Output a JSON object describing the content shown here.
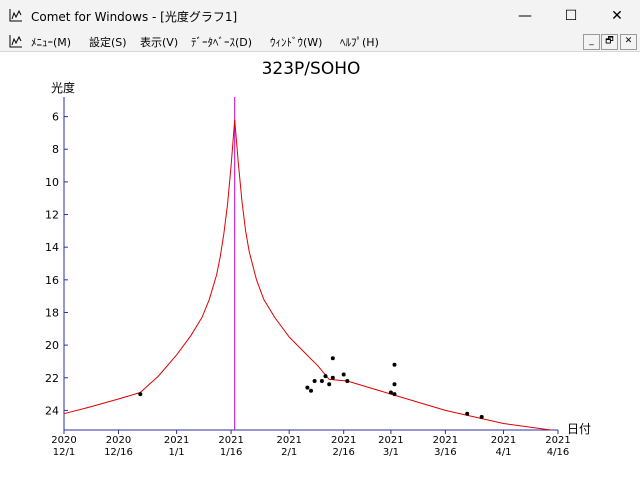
{
  "window": {
    "title": "Comet for Windows - [光度グラフ1]",
    "minimize_glyph": "—",
    "maximize_glyph": "☐",
    "close_glyph": "✕"
  },
  "menu": {
    "items": [
      {
        "label": "ﾒﾆｭｰ(M)"
      },
      {
        "label": "設定(S)"
      },
      {
        "label": "表示(V)"
      },
      {
        "label": "ﾃﾞｰﾀﾍﾞｰｽ(D)"
      },
      {
        "label": "ｳｨﾝﾄﾞｳ(W)"
      },
      {
        "label": "ﾍﾙﾌﾟ(H)"
      }
    ],
    "mdi_minimize": "_",
    "mdi_restore": "🗗",
    "mdi_close": "✕"
  },
  "chart_data": {
    "type": "line",
    "title": "323P/SOHO",
    "ylabel": "光度",
    "xlabel": "日付",
    "y_reversed": true,
    "ylim": [
      25.2,
      4.8
    ],
    "xlim": [
      "2020-12-01",
      "2021-04-16"
    ],
    "yticks": [
      6,
      8,
      10,
      12,
      14,
      16,
      18,
      20,
      22,
      24
    ],
    "xticks": [
      {
        "date": "2020-12-01",
        "line1": "2020",
        "line2": "12/1"
      },
      {
        "date": "2020-12-16",
        "line1": "2020",
        "line2": "12/16"
      },
      {
        "date": "2021-01-01",
        "line1": "2021",
        "line2": "1/1"
      },
      {
        "date": "2021-01-16",
        "line1": "2021",
        "line2": "1/16"
      },
      {
        "date": "2021-02-01",
        "line1": "2021",
        "line2": "2/1"
      },
      {
        "date": "2021-02-16",
        "line1": "2021",
        "line2": "2/16"
      },
      {
        "date": "2021-03-01",
        "line1": "2021",
        "line2": "3/1"
      },
      {
        "date": "2021-03-16",
        "line1": "2021",
        "line2": "3/16"
      },
      {
        "date": "2021-04-01",
        "line1": "2021",
        "line2": "4/1"
      },
      {
        "date": "2021-04-16",
        "line1": "2021",
        "line2": "4/16"
      }
    ],
    "perihelion_date": "2021-01-17",
    "predicted_curve": {
      "color": "#e00000",
      "points": [
        [
          "2020-12-01",
          24.2
        ],
        [
          "2020-12-08",
          23.8
        ],
        [
          "2020-12-16",
          23.3
        ],
        [
          "2020-12-22",
          22.9
        ],
        [
          "2020-12-27",
          21.9
        ],
        [
          "2021-01-01",
          20.6
        ],
        [
          "2021-01-05",
          19.4
        ],
        [
          "2021-01-08",
          18.3
        ],
        [
          "2021-01-10",
          17.2
        ],
        [
          "2021-01-12",
          15.7
        ],
        [
          "2021-01-13",
          14.6
        ],
        [
          "2021-01-14",
          13.2
        ],
        [
          "2021-01-15",
          11.4
        ],
        [
          "2021-01-16",
          9.0
        ],
        [
          "2021-01-17",
          6.2
        ],
        [
          "2021-01-18",
          8.9
        ],
        [
          "2021-01-19",
          11.2
        ],
        [
          "2021-01-20",
          13.0
        ],
        [
          "2021-01-21",
          14.3
        ],
        [
          "2021-01-23",
          16.0
        ],
        [
          "2021-01-25",
          17.2
        ],
        [
          "2021-01-28",
          18.3
        ],
        [
          "2021-02-01",
          19.5
        ],
        [
          "2021-02-05",
          20.4
        ],
        [
          "2021-02-09",
          21.3
        ],
        [
          "2021-02-12",
          22.1
        ],
        [
          "2021-02-17",
          22.2
        ],
        [
          "2021-03-01",
          23.0
        ],
        [
          "2021-03-16",
          24.0
        ],
        [
          "2021-04-01",
          24.8
        ],
        [
          "2021-04-14",
          25.2
        ]
      ]
    },
    "observations": {
      "color": "#000000",
      "points": [
        [
          "2020-12-22",
          23.0
        ],
        [
          "2021-02-06",
          22.6
        ],
        [
          "2021-02-07",
          22.8
        ],
        [
          "2021-02-08",
          22.2
        ],
        [
          "2021-02-10",
          22.2
        ],
        [
          "2021-02-11",
          21.9
        ],
        [
          "2021-02-12",
          22.4
        ],
        [
          "2021-02-13",
          22.0
        ],
        [
          "2021-02-13",
          20.8
        ],
        [
          "2021-02-16",
          21.8
        ],
        [
          "2021-02-17",
          22.2
        ],
        [
          "2021-03-01",
          22.9
        ],
        [
          "2021-03-02",
          23.0
        ],
        [
          "2021-03-02",
          22.4
        ],
        [
          "2021-03-02",
          21.2
        ],
        [
          "2021-03-22",
          24.2
        ],
        [
          "2021-03-26",
          24.4
        ]
      ]
    },
    "colors": {
      "axis": "#3030a0",
      "perihelion": "#c000c0"
    }
  }
}
